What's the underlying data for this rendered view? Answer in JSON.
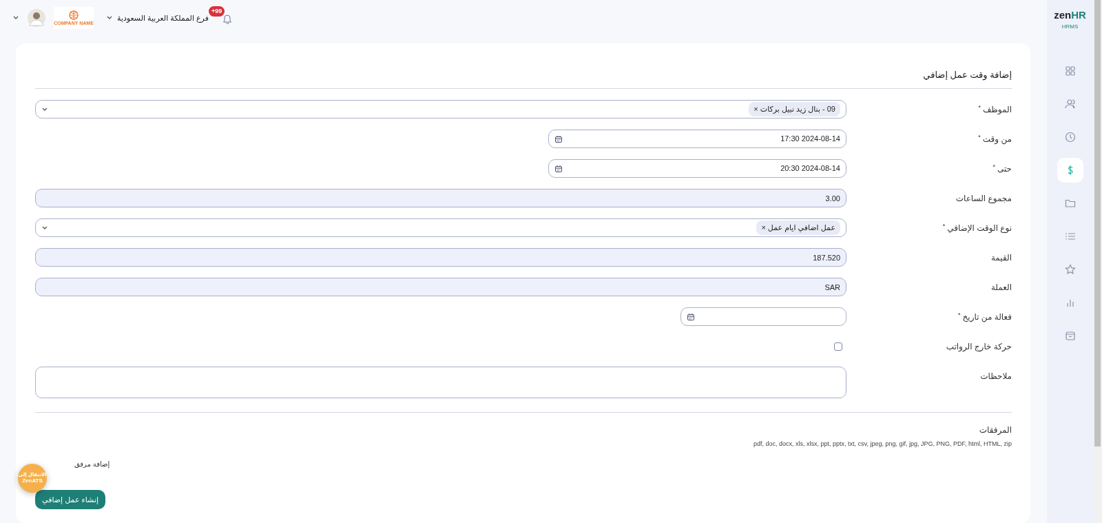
{
  "header": {
    "branch": "فرع المملكة العربية السعودية",
    "notifications": "+99",
    "company_logo_text": "COMPANY NAME"
  },
  "sidebar": {
    "brand_main": "zen",
    "brand_accent": "HR",
    "product": "HRMS",
    "items": [
      {
        "selected": false
      },
      {
        "selected": false
      },
      {
        "selected": false
      },
      {
        "selected": true
      },
      {
        "selected": false
      },
      {
        "selected": false
      },
      {
        "selected": false
      },
      {
        "selected": false
      },
      {
        "selected": false
      }
    ]
  },
  "form": {
    "title": "إضافة وقت عمل إضافي",
    "fields": [
      {
        "kind": "tags",
        "label": "الموظف",
        "required_mark": "*",
        "tags": [
          {
            "text": "09 - بنال زيد نبيل بركات",
            "remove": "×"
          }
        ]
      },
      {
        "kind": "datetime",
        "label": "من وقت",
        "required_mark": "*",
        "value": "2024-08-14 17:30"
      },
      {
        "kind": "datetime",
        "label": "حتى",
        "required_mark": "*",
        "value": "2024-08-14 20:30"
      },
      {
        "kind": "readonly",
        "label": "مجموع الساعات",
        "value": "3.00"
      },
      {
        "kind": "tags",
        "label": "نوع الوقت الإضافي",
        "required_mark": "*",
        "tags": [
          {
            "text": "عمل اضافي ايام عمل",
            "remove": "×"
          }
        ]
      },
      {
        "kind": "readonly",
        "label": "القيمة",
        "value": "187.520"
      },
      {
        "kind": "readonly",
        "label": "العملة",
        "value": "SAR"
      },
      {
        "kind": "date",
        "label": "فعالة من تاريخ",
        "required_mark": "*"
      },
      {
        "kind": "checkbox",
        "label": "حركة خارج الرواتب",
        "checked": false
      },
      {
        "kind": "textarea",
        "label": "ملاحظات"
      }
    ]
  },
  "attachments": {
    "title": "المرفقات",
    "allowed_types": "pdf, doc, docx, xls, xlsx, ppt, pptx, txt, csv, jpeg, png, gif, jpg, JPG, PNG, PDF, html, HTML, zip",
    "add_link": "إضافة مرفق"
  },
  "submit_button": "إنشاء عمل إضافي",
  "ats_shortcut": {
    "line1": "الانتقال إلى",
    "line2": "ZenATS"
  }
}
